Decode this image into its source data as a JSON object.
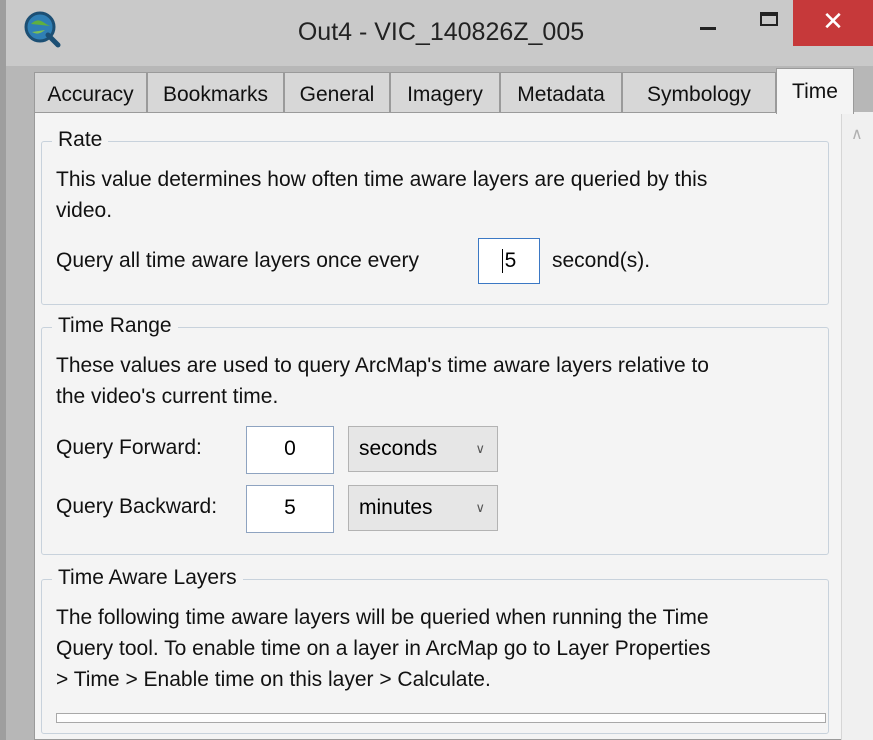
{
  "window": {
    "title": "Out4 - VIC_140826Z_005",
    "close_glyph": "✕",
    "app_icon": "globe-q-icon"
  },
  "tabs": [
    {
      "label": "Accuracy"
    },
    {
      "label": "Bookmarks"
    },
    {
      "label": "General"
    },
    {
      "label": "Imagery"
    },
    {
      "label": "Metadata"
    },
    {
      "label": "Symbology"
    },
    {
      "label": "Time",
      "active": true
    }
  ],
  "rate": {
    "legend": "Rate",
    "description_line1": "This value determines how often time aware layers are queried by this",
    "description_line2": "video.",
    "query_label": "Query all time aware layers once every",
    "interval_value": "5",
    "unit_label": "second(s)."
  },
  "time_range": {
    "legend": "Time Range",
    "description_line1": "These values are used to query ArcMap's time aware layers relative to",
    "description_line2": "the video's current time.",
    "forward_label": "Query Forward:",
    "forward_value": "0",
    "forward_unit": "seconds",
    "backward_label": "Query Backward:",
    "backward_value": "5",
    "backward_unit": "minutes"
  },
  "time_aware_layers": {
    "legend": "Time Aware Layers",
    "description_line1": "The following time aware layers will be queried when running the Time",
    "description_line2": "Query tool. To enable time on a layer in ArcMap go to Layer Properties",
    "description_line3": "> Time > Enable time on this layer > Calculate."
  },
  "colors": {
    "close_button": "#c6393a",
    "focus_border": "#3b78c4"
  }
}
